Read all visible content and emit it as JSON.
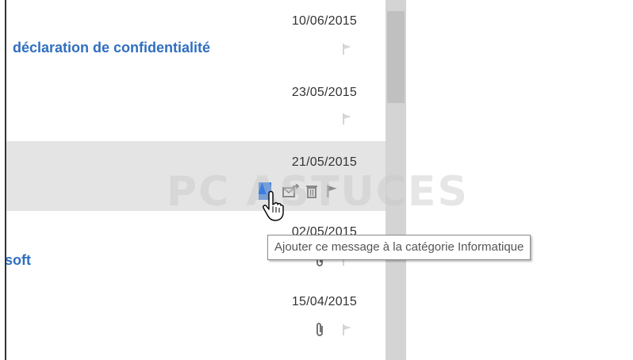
{
  "messages": [
    {
      "date": "10/06/2015",
      "subject": "déclaration de confidentialité",
      "has_attachment": false
    },
    {
      "date": "23/05/2015",
      "subject": "",
      "has_attachment": false
    },
    {
      "date": "21/05/2015",
      "subject": "",
      "has_attachment": false,
      "hovered": true
    },
    {
      "date": "02/05/2015",
      "subject": "soft",
      "has_attachment": true
    },
    {
      "date": "15/04/2015",
      "subject": "",
      "has_attachment": true
    }
  ],
  "hover_actions": {
    "category_color": "#3a7fe0",
    "icons": [
      "category-icon",
      "move-icon",
      "delete-icon",
      "flag-icon"
    ]
  },
  "tooltip": {
    "text": "Ajouter ce message à la catégorie Informatique"
  },
  "watermark": {
    "text": "PC ASTUCES"
  },
  "colors": {
    "accent": "#2f6fbf",
    "hover_row": "#e4e4e4",
    "scrollbar": "#d4d4d4"
  }
}
